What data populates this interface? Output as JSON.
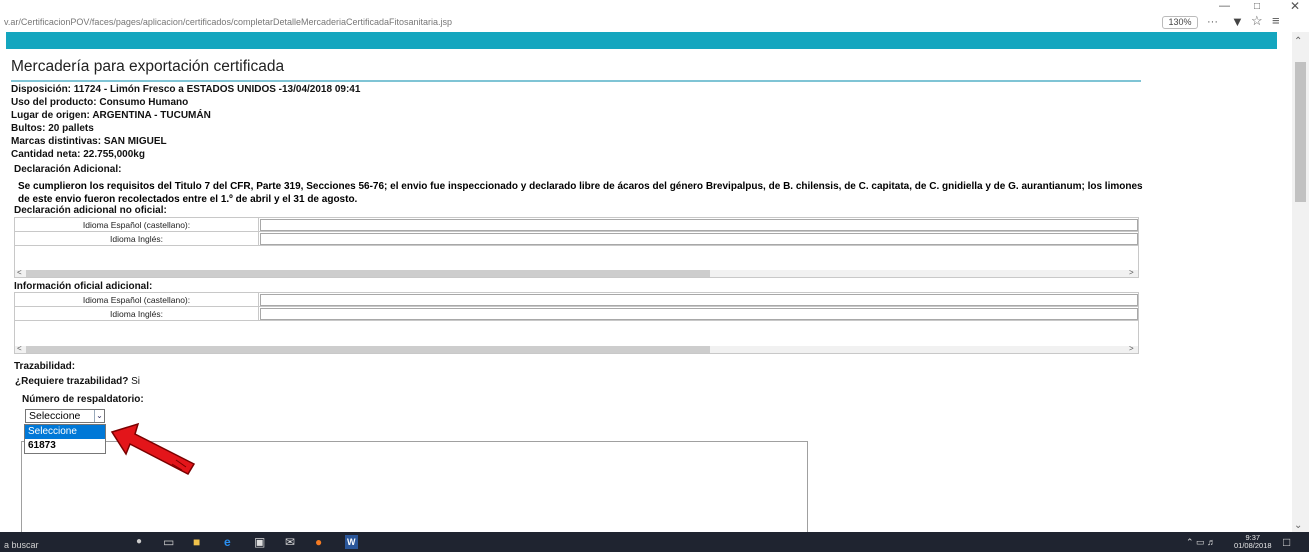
{
  "browser": {
    "url": "v.ar/CertificacionPOV/faces/pages/aplicacion/certificados/completarDetalleMercaderiaCertificadaFitosanitaria.jsp",
    "zoom": "130%",
    "icons": [
      "minimize-icon",
      "restore-icon",
      "close-icon",
      "more-icon",
      "pocket-icon",
      "bookmark-star-icon",
      "menu-icon"
    ]
  },
  "page": {
    "title": "Mercadería para exportación certificada",
    "info": [
      {
        "label": "Disposición:",
        "value": "11724 - Limón Fresco a ESTADOS UNIDOS -13/04/2018 09:41"
      },
      {
        "label": "Uso del producto:",
        "value": "Consumo Humano"
      },
      {
        "label": "Lugar de origen:",
        "value": "ARGENTINA - TUCUMÁN"
      },
      {
        "label": "Bultos:",
        "value": "20 pallets"
      },
      {
        "label": "Marcas distintivas:",
        "value": "SAN MIGUEL"
      },
      {
        "label": "Cantidad neta:",
        "value": "22.755,000kg"
      }
    ],
    "declaracion_title": "Declaración Adicional:",
    "declaracion_text": "Se cumplieron los requisitos del Titulo 7 del CFR, Parte 319, Secciones 56-76; el envio fue inspeccionado y declarado libre de ácaros del género Brevipalpus, de B. chilensis, de C. capitata, de C. gnidiella y de G. aurantianum; los limones de este envio fueron recolectados entre el 1.º de abril y el 31 de agosto.",
    "no_oficial": {
      "title": "Declaración adicional no oficial:",
      "row1_label": "Idioma Español (castellano):",
      "row2_label": "Idioma Inglés:"
    },
    "info_oficial": {
      "title": "Información oficial adicional:",
      "row1_label": "Idioma Español (castellano):",
      "row2_label": "Idioma Inglés:"
    },
    "trazabilidad": {
      "title": "Trazabilidad:",
      "question": "¿Requiere trazabilidad?",
      "answer": "Si",
      "respaldatorio_label": "Número de respaldatorio:",
      "select_value": "Seleccione",
      "options": [
        "Seleccione",
        "61873"
      ]
    }
  },
  "taskbar": {
    "search": "a buscar",
    "time": "9:37",
    "date": "01/08/2018"
  }
}
